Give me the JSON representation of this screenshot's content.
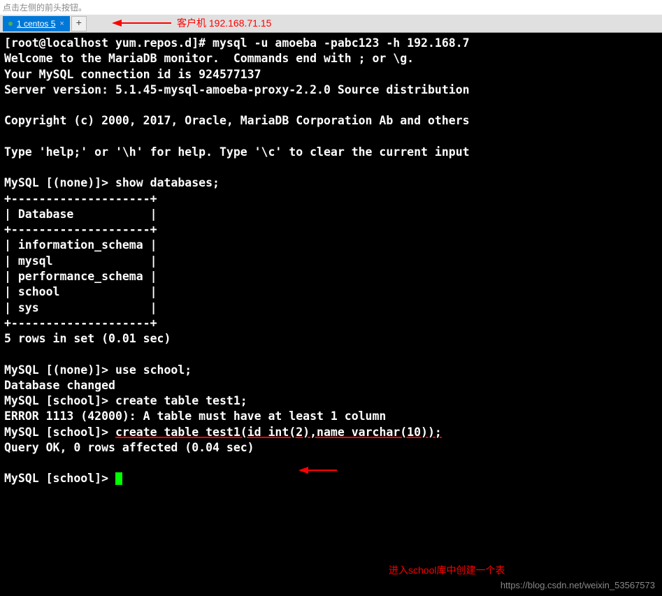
{
  "top_hint": "点击左侧的前头按钮。",
  "tab": {
    "label": "1 centos 5",
    "close": "×",
    "add": "+"
  },
  "annotation_top": "客户机 192.168.71.15",
  "terminal": {
    "line1_prompt": "[root@localhost yum.repos.d]# ",
    "line1_cmd": "mysql -u amoeba -pabc123 -h 192.168.7",
    "line2": "Welcome to the MariaDB monitor.  Commands end with ; or \\g.",
    "line3": "Your MySQL connection id is 924577137",
    "line4": "Server version: 5.1.45-mysql-amoeba-proxy-2.2.0 Source distribution",
    "line5": "",
    "line6": "Copyright (c) 2000, 2017, Oracle, MariaDB Corporation Ab and others",
    "line7": "",
    "line8": "Type 'help;' or '\\h' for help. Type '\\c' to clear the current input",
    "line9": "",
    "line10": "MySQL [(none)]> show databases;",
    "border": "+--------------------+",
    "header": "| Database           |",
    "row1": "| information_schema |",
    "row2": "| mysql              |",
    "row3": "| performance_schema |",
    "row4": "| school             |",
    "row5": "| sys                |",
    "rows_msg": "5 rows in set (0.01 sec)",
    "use_prompt": "MySQL [(none)]> ",
    "use_cmd": "use school;",
    "db_changed": "Database changed",
    "create1_prompt": "MySQL [school]> ",
    "create1_cmd": "create table test1;",
    "error_msg": "ERROR 1113 (42000): A table must have at least 1 column",
    "create2_prompt": "MySQL [school]> ",
    "create2_cmd": "create table test1(id int(2),name varchar(10));",
    "query_ok": "Query OK, 0 rows affected (0.04 sec)",
    "final_prompt": "MySQL [school]> "
  },
  "annotation_bottom": "进入school库中创建一个表",
  "watermark": "https://blog.csdn.net/weixin_53567573"
}
